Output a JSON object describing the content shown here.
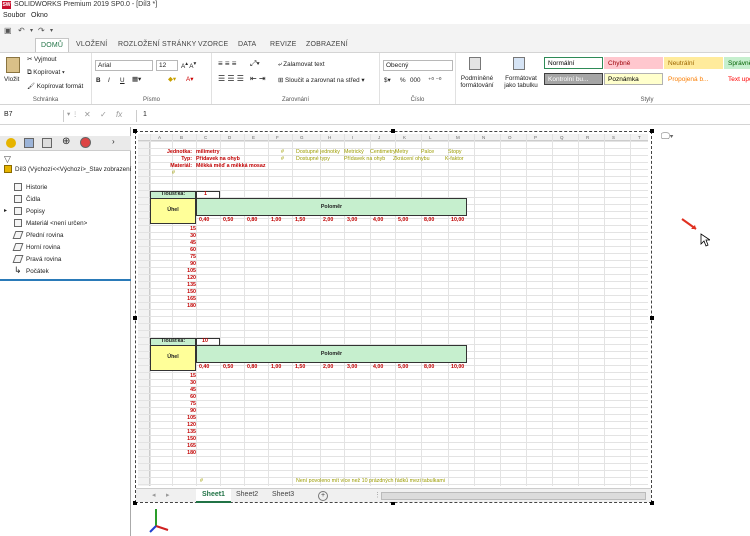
{
  "titlebar": {
    "logo": "SW",
    "title": "SOLIDWORKS Premium 2019 SP0.0 - [Díl3 *]"
  },
  "menu": {
    "items": [
      "Soubor",
      "Okno"
    ]
  },
  "ribbon_tabs": [
    "DOMŮ",
    "VLOŽENÍ",
    "ROZLOŽENÍ STRÁNKY",
    "VZORCE",
    "DATA",
    "REVIZE",
    "ZOBRAZENÍ"
  ],
  "ribbon": {
    "paste": "Vložit",
    "cut": "Vyjmout",
    "copy": "Kopírovat",
    "format_painter": "Kopírovat formát",
    "clipboard_group": "Schránka",
    "font_name": "Arial",
    "font_size": "12",
    "bold": "B",
    "italic": "I",
    "underline": "U",
    "font_group": "Písmo",
    "wrap_text": "Zalamovat text",
    "merge_center": "Sloučit a zarovnat na střed",
    "alignment_group": "Zarovnání",
    "number_format": "Obecný",
    "percent": "%",
    "thousands": "000",
    "number_group": "Číslo",
    "conditional": "Podmíněné formátování",
    "format_table": "Formátovat jako tabulku",
    "styles_group": "Styly",
    "styles": [
      {
        "label": "Normální",
        "bg": "#ffffff",
        "fg": "#000000",
        "border": "#2e8b57"
      },
      {
        "label": "Chybně",
        "bg": "#ffc7ce",
        "fg": "#9c0006",
        "border": "#ffc7ce"
      },
      {
        "label": "Neutrální",
        "bg": "#ffeb9c",
        "fg": "#9c6500",
        "border": "#ffeb9c"
      },
      {
        "label": "Správně",
        "bg": "#c6efce",
        "fg": "#006100",
        "border": "#c6efce"
      },
      {
        "label": "Kontrolní bu...",
        "bg": "#a5a5a5",
        "fg": "#ffffff",
        "border": "#3f3f3f"
      },
      {
        "label": "Poznámka",
        "bg": "#ffffcc",
        "fg": "#000000",
        "border": "#b2b2b2"
      },
      {
        "label": "Propojená b...",
        "bg": "#ffffff",
        "fg": "#fa7d00",
        "border": "#ffffff"
      },
      {
        "label": "Text upo...",
        "bg": "#ffffff",
        "fg": "#ff0000",
        "border": "#ffffff"
      }
    ]
  },
  "formula_bar": {
    "cell_ref": "B7",
    "value": "1"
  },
  "feature_tree": {
    "root": "Díl3 (Výchozí<<Výchozí>_Stav zobrazení",
    "items": [
      "Historie",
      "Čidla",
      "Popisy",
      "Materiál <není určen>",
      "Přední rovina",
      "Horní rovina",
      "Pravá rovina",
      "Počátek"
    ]
  },
  "sheet": {
    "col_headers": [
      "A",
      "B",
      "C",
      "D",
      "E",
      "F",
      "G",
      "H",
      "I",
      "J",
      "K",
      "L",
      "M",
      "N",
      "O",
      "P",
      "Q",
      "R",
      "S",
      "T",
      "U",
      "V"
    ],
    "info": {
      "units_label": "Jednotka:",
      "units_value": "milimetry",
      "type_label": "Typ:",
      "type_value": "Přídavek na ohyb",
      "material_label": "Materiál:",
      "material_value": "Měkká měď a měkká mosaz",
      "hash": "#"
    },
    "header_row1": [
      "#",
      "Dostupné jednotky",
      "Metrický",
      "Centimetry",
      "Metry",
      "Palce",
      "Stopy"
    ],
    "header_row2": [
      "#",
      "Dostupné typy",
      "Přídavek na ohyb",
      "Zkrácení ohybu",
      "K-faktor"
    ],
    "table1": {
      "thickness_label": "Tloušťka:",
      "thickness_value": "1",
      "radius_label": "Poloměr",
      "angle_label": "Úhel"
    },
    "table2": {
      "thickness_label": "Tloušťka:",
      "thickness_value": "10",
      "radius_label": "Poloměr",
      "angle_label": "Úhel"
    },
    "radii": [
      "0,40",
      "0,50",
      "0,80",
      "1,00",
      "1,50",
      "2,00",
      "3,00",
      "4,00",
      "5,00",
      "8,00",
      "10,00"
    ],
    "angles": [
      "15",
      "30",
      "45",
      "60",
      "75",
      "90",
      "105",
      "120",
      "135",
      "150",
      "165",
      "180"
    ],
    "note": "Není povoleno mít více než 10 prázdných řádků mezi tabulkami",
    "tabs": [
      "Sheet1",
      "Sheet2",
      "Sheet3"
    ]
  }
}
